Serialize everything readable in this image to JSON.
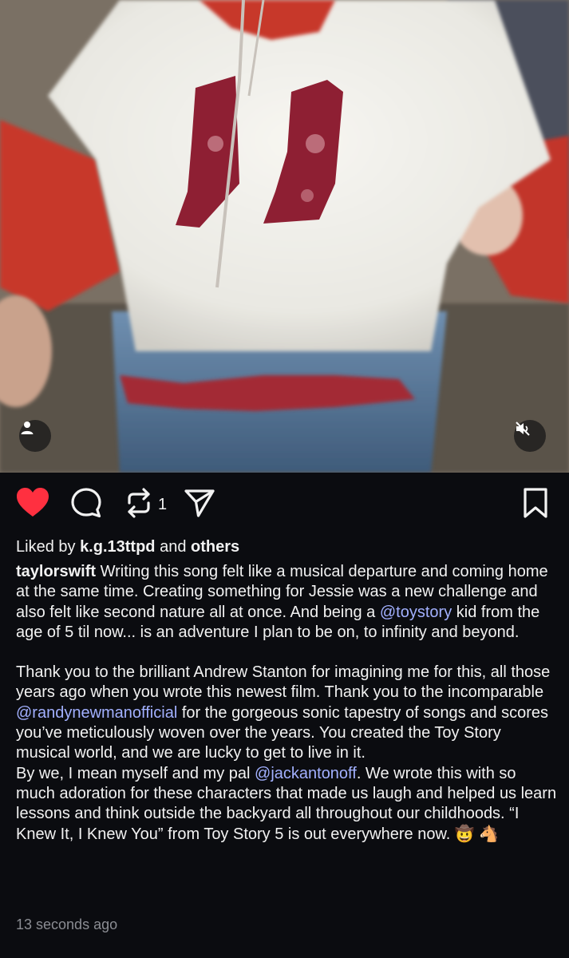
{
  "post": {
    "repost_count": "1",
    "liked_by": {
      "prefix": "Liked by",
      "user": "k.g.13ttpd",
      "connector": "and",
      "others": "others"
    },
    "caption": {
      "username": "taylorswift",
      "p1_part1": "Writing this song felt like a musical departure and coming home at the same time. Creating something for Jessie was a new challenge and also felt like second nature all at once. And being a",
      "p1_mention": "@toystory",
      "p1_part2": "kid from the age of 5 til now... is an adventure I plan to be on, to infinity and beyond.",
      "p2_part1": "Thank you to the brilliant Andrew Stanton for imagining me for this, all those years ago when you wrote this newest film. Thank you to the incomparable",
      "p2_mention": "@randynewmanofficial",
      "p2_part2": "for the gorgeous sonic tapestry of songs and scores you’ve meticulously woven over the years. You created the Toy Story musical world, and we are lucky to get to live in it.",
      "p3_part1": "By we, I mean myself and my pal",
      "p3_mention": "@jackantonoff",
      "p3_part2": ". We wrote this with so much adoration for these characters that made us laugh and helped us learn lessons and think outside the backyard all throughout our childhoods. “I Knew It, I Knew You” from Toy Story 5 is out everywhere now.",
      "emoji_cowboy": "🤠",
      "emoji_horse": "🐴"
    },
    "timestamp": "13 seconds ago"
  },
  "icons": {
    "like": "heart-filled-icon",
    "comment": "comment-bubble-icon",
    "repost": "repost-arrows-icon",
    "share": "paper-plane-icon",
    "save": "bookmark-icon",
    "user_tag": "person-icon",
    "mute": "speaker-muted-icon"
  },
  "colors": {
    "background": "#0b0c10",
    "like_red": "#ff3040",
    "mention_blue": "#a2b0ff",
    "muted_text": "#8b8d93"
  }
}
